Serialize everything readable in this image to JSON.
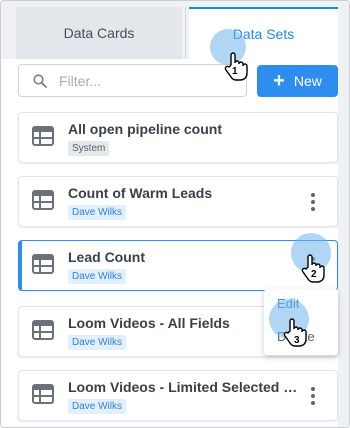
{
  "tabs": {
    "data_cards": "Data Cards",
    "data_sets": "Data Sets",
    "active": "data_sets"
  },
  "search": {
    "placeholder": "Filter...",
    "value": ""
  },
  "new_button": {
    "label": "New"
  },
  "datasets": [
    {
      "title": "All open pipeline count",
      "badge": "System",
      "badge_kind": "system"
    },
    {
      "title": "Count of Warm Leads",
      "badge": "Dave Wilks",
      "badge_kind": "owner"
    },
    {
      "title": "Lead Count",
      "badge": "Dave Wilks",
      "badge_kind": "owner",
      "selected": true
    },
    {
      "title": "Loom Videos - All Fields",
      "badge": "Dave Wilks",
      "badge_kind": "owner"
    },
    {
      "title": "Loom Videos - Limited Selected Fie...",
      "badge": "Dave Wilks",
      "badge_kind": "owner"
    }
  ],
  "context_menu": {
    "items": [
      "Edit",
      "Delete"
    ]
  },
  "annotations": {
    "step1": "1",
    "step2": "2",
    "step3": "3"
  },
  "colors": {
    "accent": "#2e8ef0",
    "click_highlight": "#6fb2ec"
  }
}
